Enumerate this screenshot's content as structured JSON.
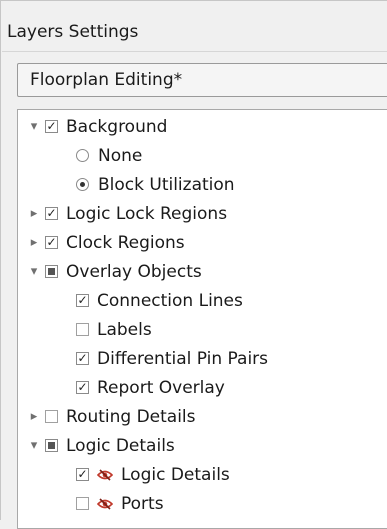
{
  "panel": {
    "title": "Layers Settings"
  },
  "preset": {
    "selected": "Floorplan Editing*"
  },
  "tree": {
    "background": {
      "label": "Background",
      "expanded": true,
      "state": "checked"
    },
    "none": {
      "label": "None",
      "selected": false
    },
    "block_utilization": {
      "label": "Block Utilization",
      "selected": true
    },
    "logic_lock_regions": {
      "label": "Logic Lock Regions",
      "expanded": false,
      "state": "checked"
    },
    "clock_regions": {
      "label": "Clock Regions",
      "expanded": false,
      "state": "checked"
    },
    "overlay_objects": {
      "label": "Overlay Objects",
      "expanded": true,
      "state": "partial"
    },
    "connection_lines": {
      "label": "Connection Lines",
      "state": "checked"
    },
    "labels": {
      "label": "Labels",
      "state": "unchecked"
    },
    "differential_pin_pairs": {
      "label": "Differential Pin Pairs",
      "state": "checked"
    },
    "report_overlay": {
      "label": "Report Overlay",
      "state": "checked"
    },
    "routing_details": {
      "label": "Routing Details",
      "expanded": false,
      "state": "unchecked"
    },
    "logic_details": {
      "label": "Logic Details",
      "expanded": true,
      "state": "partial"
    },
    "logic_details_child": {
      "label": "Logic Details",
      "state": "checked",
      "icon": "visibility-hidden-icon"
    },
    "ports": {
      "label": "Ports",
      "state": "unchecked",
      "icon": "visibility-hidden-icon"
    }
  },
  "colors": {
    "eye_icon": "#c0392b",
    "panel_bg": "#f0f0f0",
    "tree_bg": "#ffffff"
  }
}
